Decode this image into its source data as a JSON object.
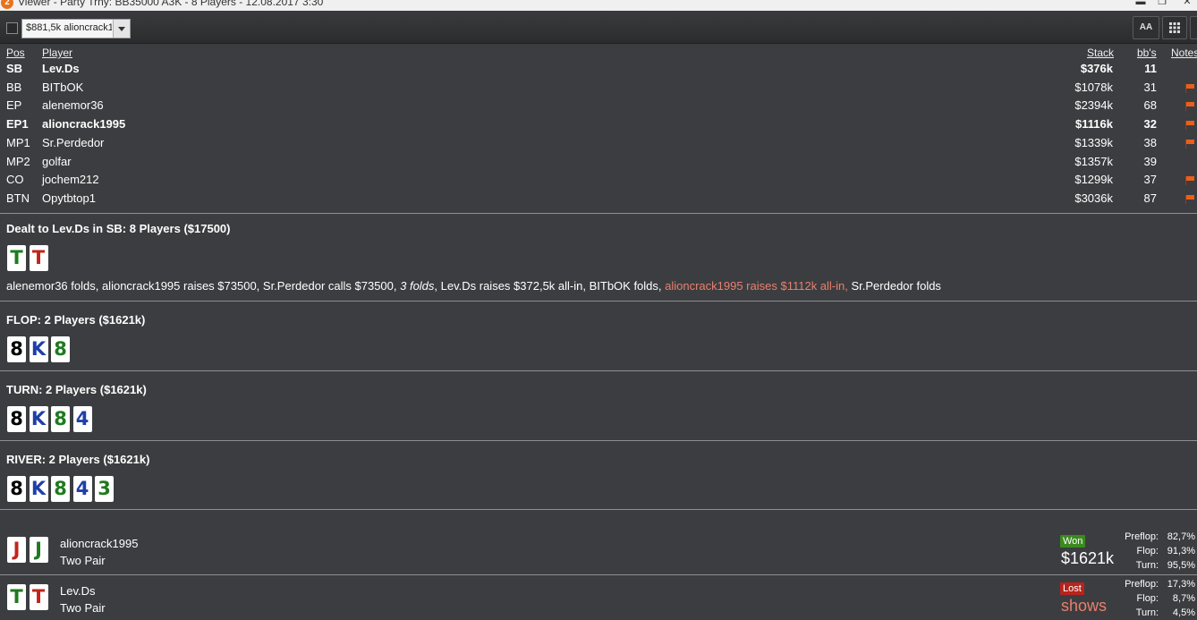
{
  "window": {
    "title": "Viewer - Party Trny: BB35000 A3K - 8 Players - 12.08.2017 3:30",
    "app_icon_glyph": "2"
  },
  "toolbar": {
    "hand_selector_value": "$881,5k alioncrack1",
    "font_size_button_label": "AA",
    "grid_icon": "grid-icon"
  },
  "players_table": {
    "headers": {
      "pos": "Pos",
      "player": "Player",
      "stack": "Stack",
      "bbs": "bb's",
      "notes": "Notes"
    },
    "rows": [
      {
        "pos": "SB",
        "name": "Lev.Ds",
        "stack": "$376k",
        "bbs": "11",
        "bold": true,
        "note_flag": false
      },
      {
        "pos": "BB",
        "name": "BITbOK",
        "stack": "$1078k",
        "bbs": "31",
        "bold": false,
        "note_flag": true
      },
      {
        "pos": "EP",
        "name": "alenemor36",
        "stack": "$2394k",
        "bbs": "68",
        "bold": false,
        "note_flag": true
      },
      {
        "pos": "EP1",
        "name": "alioncrack1995",
        "stack": "$1116k",
        "bbs": "32",
        "bold": true,
        "note_flag": true
      },
      {
        "pos": "MP1",
        "name": "Sr.Perdedor",
        "stack": "$1339k",
        "bbs": "38",
        "bold": false,
        "note_flag": true
      },
      {
        "pos": "MP2",
        "name": "golfar",
        "stack": "$1357k",
        "bbs": "39",
        "bold": false,
        "note_flag": false
      },
      {
        "pos": "CO",
        "name": "jochem212",
        "stack": "$1299k",
        "bbs": "37",
        "bold": false,
        "note_flag": true
      },
      {
        "pos": "BTN",
        "name": "Opytbtop1",
        "stack": "$3036k",
        "bbs": "87",
        "bold": false,
        "note_flag": true
      }
    ]
  },
  "preflop": {
    "title": "Dealt to Lev.Ds in SB: 8 Players ($17500)",
    "cards": [
      {
        "rank": "T",
        "color": "#1f7a1f"
      },
      {
        "rank": "T",
        "color": "#c0251b"
      }
    ],
    "actions": {
      "a1": "alenemor36 folds, alioncrack1995 raises $73500, Sr.Perdedor calls $73500, ",
      "a2": "3 folds",
      "a3": ", Lev.Ds raises $372,5k all-in, BITbOK folds, ",
      "a4": "alioncrack1995 raises $1112k all-in,",
      "a5": " Sr.Perdedor folds"
    }
  },
  "streets": [
    {
      "title": "FLOP: 2 Players ($1621k)",
      "cards": [
        {
          "rank": "8",
          "color": "#000000"
        },
        {
          "rank": "K",
          "color": "#1f3fa8"
        },
        {
          "rank": "8",
          "color": "#1f7a1f"
        }
      ]
    },
    {
      "title": "TURN: 2 Players ($1621k)",
      "cards": [
        {
          "rank": "8",
          "color": "#000000"
        },
        {
          "rank": "K",
          "color": "#1f3fa8"
        },
        {
          "rank": "8",
          "color": "#1f7a1f"
        },
        {
          "rank": "4",
          "color": "#1f3fa8"
        }
      ]
    },
    {
      "title": "RIVER: 2 Players ($1621k)",
      "cards": [
        {
          "rank": "8",
          "color": "#000000"
        },
        {
          "rank": "K",
          "color": "#1f3fa8"
        },
        {
          "rank": "8",
          "color": "#1f7a1f"
        },
        {
          "rank": "4",
          "color": "#1f3fa8"
        },
        {
          "rank": "3",
          "color": "#1f7a1f"
        }
      ]
    }
  ],
  "results": [
    {
      "player": "alioncrack1995",
      "hand": "Two Pair",
      "cards": [
        {
          "rank": "J",
          "color": "#c0251b"
        },
        {
          "rank": "J",
          "color": "#1f7a1f"
        }
      ],
      "badge": "Won",
      "badge_color": "#3a8a1e",
      "amount": "$1621k",
      "amount_color": "#ffffff",
      "equity": [
        {
          "label": "Preflop:",
          "value": "82,7%"
        },
        {
          "label": "Flop:",
          "value": "91,3%"
        },
        {
          "label": "Turn:",
          "value": "95,5%"
        }
      ]
    },
    {
      "player": "Lev.Ds",
      "hand": "Two Pair",
      "cards": [
        {
          "rank": "T",
          "color": "#1f7a1f"
        },
        {
          "rank": "T",
          "color": "#c0251b"
        }
      ],
      "badge": "Lost",
      "badge_color": "#b8231b",
      "amount": "shows",
      "amount_color": "#e8806d",
      "equity": [
        {
          "label": "Preflop:",
          "value": "17,3%"
        },
        {
          "label": "Flop:",
          "value": "8,7%"
        },
        {
          "label": "Turn:",
          "value": "4,5%"
        }
      ]
    }
  ]
}
